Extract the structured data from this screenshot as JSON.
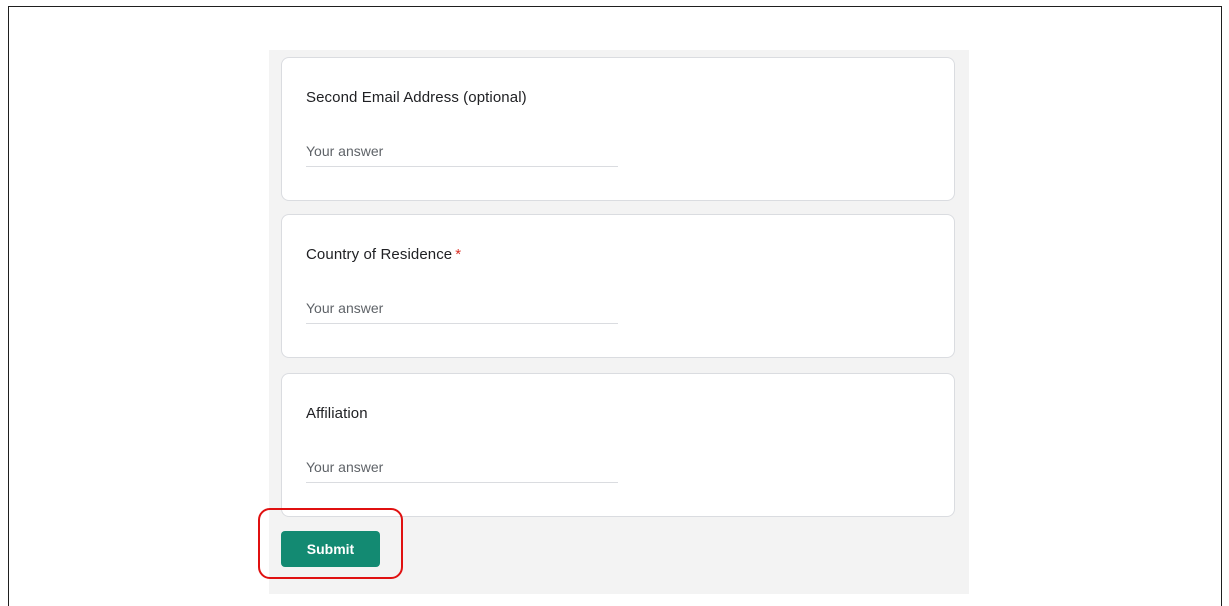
{
  "form": {
    "questions": [
      {
        "label": "Second Email Address (optional)",
        "required": false,
        "placeholder": "Your answer",
        "value": ""
      },
      {
        "label": "Country of Residence",
        "required": true,
        "required_mark": "*",
        "placeholder": "Your answer",
        "value": ""
      },
      {
        "label": "Affiliation",
        "required": false,
        "placeholder": "Your answer",
        "value": ""
      }
    ],
    "submit_label": "Submit"
  },
  "colors": {
    "submit_button": "#138a72",
    "required_mark": "#d93025",
    "highlight": "#e01010",
    "form_background": "#f3f3f3"
  }
}
